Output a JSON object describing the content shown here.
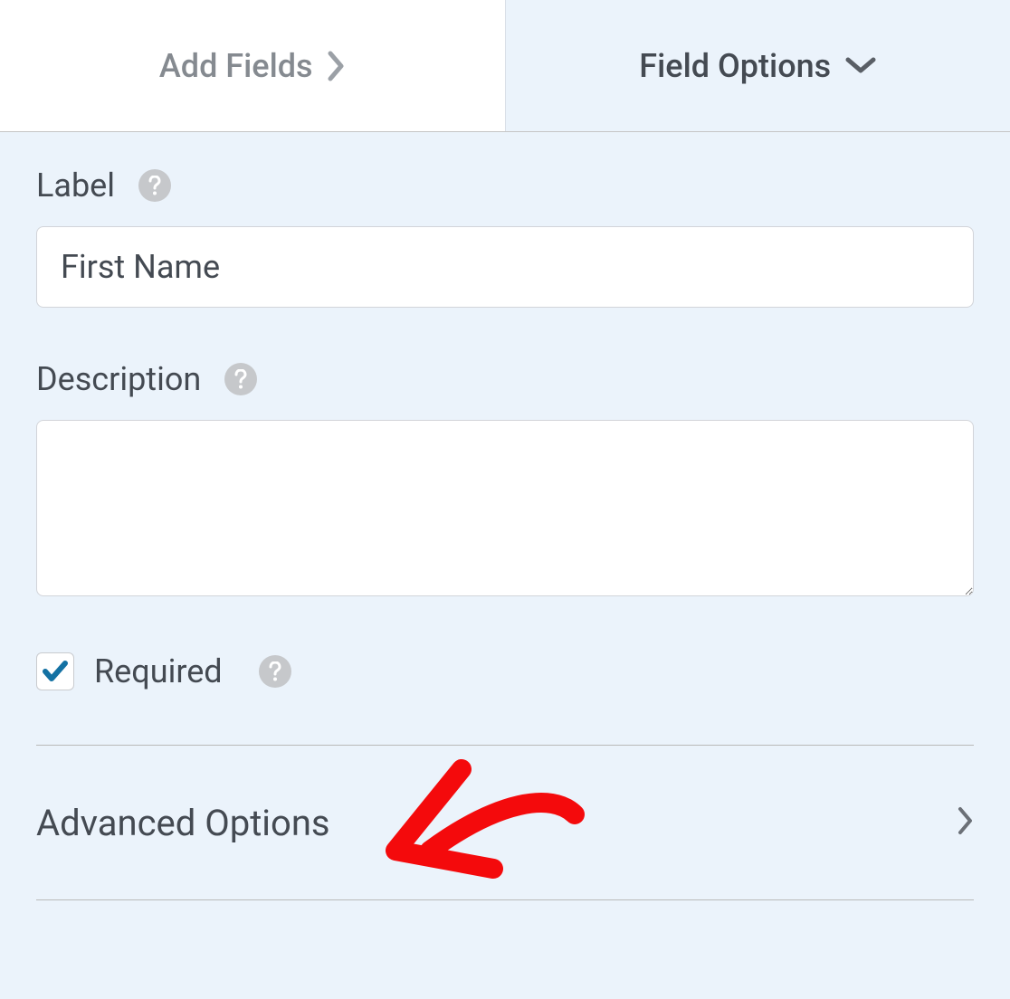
{
  "tabs": {
    "add_fields": "Add Fields",
    "field_options": "Field Options"
  },
  "fields": {
    "label": {
      "title": "Label",
      "value": "First Name"
    },
    "description": {
      "title": "Description",
      "value": ""
    },
    "required": {
      "title": "Required",
      "checked": true
    }
  },
  "advanced": {
    "title": "Advanced Options"
  }
}
